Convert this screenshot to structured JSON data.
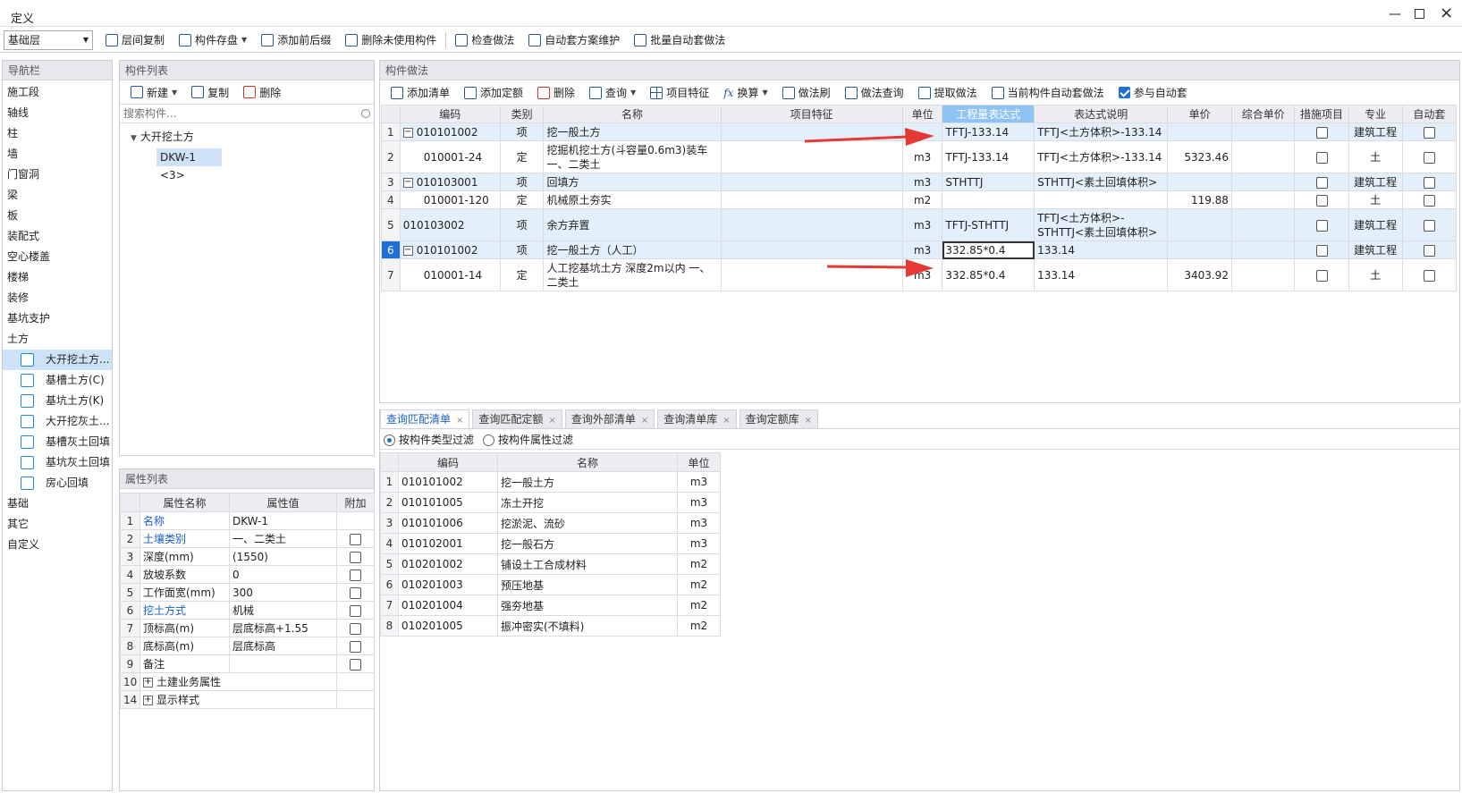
{
  "window": {
    "title": "定义"
  },
  "topbar": {
    "floor_select": "基础层",
    "buttons": [
      "层间复制",
      "构件存盘",
      "添加前后缀",
      "删除未使用构件",
      "检查做法",
      "自动套方案维护",
      "批量自动套做法"
    ]
  },
  "nav": {
    "title": "导航栏",
    "items": [
      "施工段",
      "轴线",
      "柱",
      "墙",
      "门窗洞",
      "梁",
      "板",
      "装配式",
      "空心楼盖",
      "楼梯",
      "装修",
      "基坑支护",
      "土方"
    ],
    "sub_items": [
      "大开挖土方...",
      "基槽土方(C)",
      "基坑土方(K)",
      "大开挖灰土...",
      "基槽灰土回填",
      "基坑灰土回填",
      "房心回填"
    ],
    "after_items": [
      "基础",
      "其它",
      "自定义"
    ]
  },
  "component_list": {
    "title": "构件列表",
    "new_label": "新建",
    "copy_label": "复制",
    "delete_label": "删除",
    "search_placeholder": "搜索构件...",
    "tree_root": "大开挖土方",
    "tree_child": "DKW-1 <3>"
  },
  "properties": {
    "title": "属性列表",
    "headers": [
      "属性名称",
      "属性值",
      "附加"
    ],
    "rows": [
      {
        "n": "1",
        "name": "名称",
        "value": "DKW-1",
        "link": true,
        "chk": false
      },
      {
        "n": "2",
        "name": "土壤类别",
        "value": "一、二类土",
        "link": true,
        "chk": true
      },
      {
        "n": "3",
        "name": "深度(mm)",
        "value": "(1550)",
        "link": false,
        "chk": true
      },
      {
        "n": "4",
        "name": "放坡系数",
        "value": "0",
        "link": false,
        "chk": true
      },
      {
        "n": "5",
        "name": "工作面宽(mm)",
        "value": "300",
        "link": false,
        "chk": true
      },
      {
        "n": "6",
        "name": "挖土方式",
        "value": "机械",
        "link": true,
        "chk": true
      },
      {
        "n": "7",
        "name": "顶标高(m)",
        "value": "层底标高+1.55",
        "link": false,
        "chk": true
      },
      {
        "n": "8",
        "name": "底标高(m)",
        "value": "层底标高",
        "link": false,
        "chk": true
      },
      {
        "n": "9",
        "name": "备注",
        "value": "",
        "link": false,
        "chk": true
      },
      {
        "n": "10",
        "name": "土建业务属性",
        "value": "",
        "link": false,
        "chk": false,
        "group": true
      },
      {
        "n": "14",
        "name": "显示样式",
        "value": "",
        "link": false,
        "chk": false,
        "group": true
      }
    ]
  },
  "method": {
    "title": "构件做法",
    "toolbar": [
      "添加清单",
      "添加定额",
      "删除",
      "查询",
      "项目特征",
      "换算",
      "做法刷",
      "做法查询",
      "提取做法",
      "当前构件自动套做法"
    ],
    "auto_label": "参与自动套",
    "headers": [
      "编码",
      "类别",
      "名称",
      "项目特征",
      "单位",
      "工程量表达式",
      "表达式说明",
      "单价",
      "综合单价",
      "措施项目",
      "专业",
      "自动套"
    ],
    "rows": [
      {
        "n": "1",
        "code": "010101002",
        "type": "项",
        "name": "挖一般土方",
        "unit": "",
        "expr": "TFTJ-133.14",
        "desc": "TFTJ<土方体积>-133.14",
        "price": "",
        "major": "建筑工程",
        "list": true,
        "exp": true
      },
      {
        "n": "2",
        "code": "010001-24",
        "type": "定",
        "name": "挖掘机挖土方(斗容量0.6m3)装车 一、二类土",
        "unit": "m3",
        "expr": "TFTJ-133.14",
        "desc": "TFTJ<土方体积>-133.14",
        "price": "5323.46",
        "major": "土",
        "list": false
      },
      {
        "n": "3",
        "code": "010103001",
        "type": "项",
        "name": "回填方",
        "unit": "m3",
        "expr": "STHTTJ",
        "desc": "STHTTJ<素土回填体积>",
        "price": "",
        "major": "建筑工程",
        "list": true,
        "exp": true
      },
      {
        "n": "4",
        "code": "010001-120",
        "type": "定",
        "name": "机械原土夯实",
        "unit": "m2",
        "expr": "",
        "desc": "",
        "price": "119.88",
        "major": "土",
        "list": false
      },
      {
        "n": "5",
        "code": "010103002",
        "type": "项",
        "name": "余方弃置",
        "unit": "m3",
        "expr": "TFTJ-STHTTJ",
        "desc": "TFTJ<土方体积>-STHTTJ<素土回填体积>",
        "price": "",
        "major": "建筑工程",
        "list": true,
        "exp": false
      },
      {
        "n": "6",
        "code": "010101002",
        "type": "项",
        "name": "挖一般土方（人工）",
        "unit": "m3",
        "expr": "332.85*0.4",
        "desc": "133.14",
        "price": "",
        "major": "建筑工程",
        "list": true,
        "exp": true,
        "selected": true
      },
      {
        "n": "7",
        "code": "010001-14",
        "type": "定",
        "name": "人工挖基坑土方 深度2m以内 一、二类土",
        "unit": "m3",
        "expr": "332.85*0.4",
        "desc": "133.14",
        "price": "3403.92",
        "major": "土",
        "list": false
      }
    ]
  },
  "query": {
    "tabs": [
      "查询匹配清单",
      "查询匹配定额",
      "查询外部清单",
      "查询清单库",
      "查询定额库"
    ],
    "filter1": "按构件类型过滤",
    "filter2": "按构件属性过滤",
    "headers": [
      "编码",
      "名称",
      "单位"
    ],
    "rows": [
      {
        "n": "1",
        "code": "010101002",
        "name": "挖一般土方",
        "unit": "m3"
      },
      {
        "n": "2",
        "code": "010101005",
        "name": "冻土开挖",
        "unit": "m3"
      },
      {
        "n": "3",
        "code": "010101006",
        "name": "挖淤泥、流砂",
        "unit": "m3"
      },
      {
        "n": "4",
        "code": "010102001",
        "name": "挖一般石方",
        "unit": "m3"
      },
      {
        "n": "5",
        "code": "010201002",
        "name": "铺设土工合成材料",
        "unit": "m2"
      },
      {
        "n": "6",
        "code": "010201003",
        "name": "预压地基",
        "unit": "m2"
      },
      {
        "n": "7",
        "code": "010201004",
        "name": "强夯地基",
        "unit": "m2"
      },
      {
        "n": "8",
        "code": "010201005",
        "name": "振冲密实(不填料)",
        "unit": "m2"
      }
    ]
  },
  "colors": {
    "accent": "#1e6fd9",
    "selected_header": "#8fc3f5",
    "list_row": "#e3f0fb",
    "arrow": "#e53935"
  }
}
